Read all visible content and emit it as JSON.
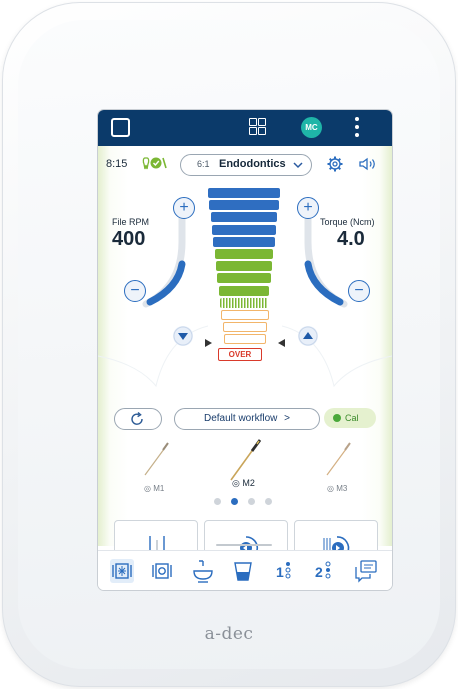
{
  "device": {
    "brand_logo": "a-dec"
  },
  "topbar": {
    "icons": [
      "home-icon",
      "apps-grid-icon",
      "avatar",
      "more-vertical-icon"
    ],
    "avatar_initials": "MC"
  },
  "status": {
    "time": "8:15",
    "procedure_ratio": "6:1",
    "procedure_name": "Endodontics",
    "icons": [
      "tooth-check-icon",
      "chevron-down-icon",
      "gear-icon",
      "speaker-icon"
    ]
  },
  "rpm": {
    "label": "File RPM",
    "value": "400"
  },
  "torque": {
    "label": "Torque (Ncm)",
    "value": "4.0"
  },
  "gauge": {
    "over_label": "OVER",
    "blue_bars": 5,
    "green_bars": 4,
    "striped_bars": 1,
    "outline_bars": 3,
    "colors": {
      "blue": "#2f6ec1",
      "green": "#7bb734",
      "orange": "#f2b56a",
      "red": "#d93a2b"
    }
  },
  "workflow": {
    "label": "Default workflow",
    "chevron": ">",
    "cal_label": "Cal"
  },
  "files": {
    "items": [
      {
        "label": "M1",
        "active": false
      },
      {
        "label": "M2",
        "active": true
      },
      {
        "label": "M3",
        "active": false
      }
    ],
    "page_count": 4,
    "current_page": 2
  },
  "modes": [
    "single-file-mode-icon",
    "reciprocate-mode-icon",
    "apical-stop-mode-icon"
  ],
  "bottom_nav": [
    "bur-tab-icon",
    "camera-tab-icon",
    "cuspidor-tab-icon",
    "cup-fill-tab-icon",
    "position-1-icon",
    "position-2-icon",
    "messages-icon"
  ],
  "colors": {
    "navy": "#0b3a6a",
    "accent_blue": "#2b6dbf",
    "accent_green": "#7bb734"
  }
}
